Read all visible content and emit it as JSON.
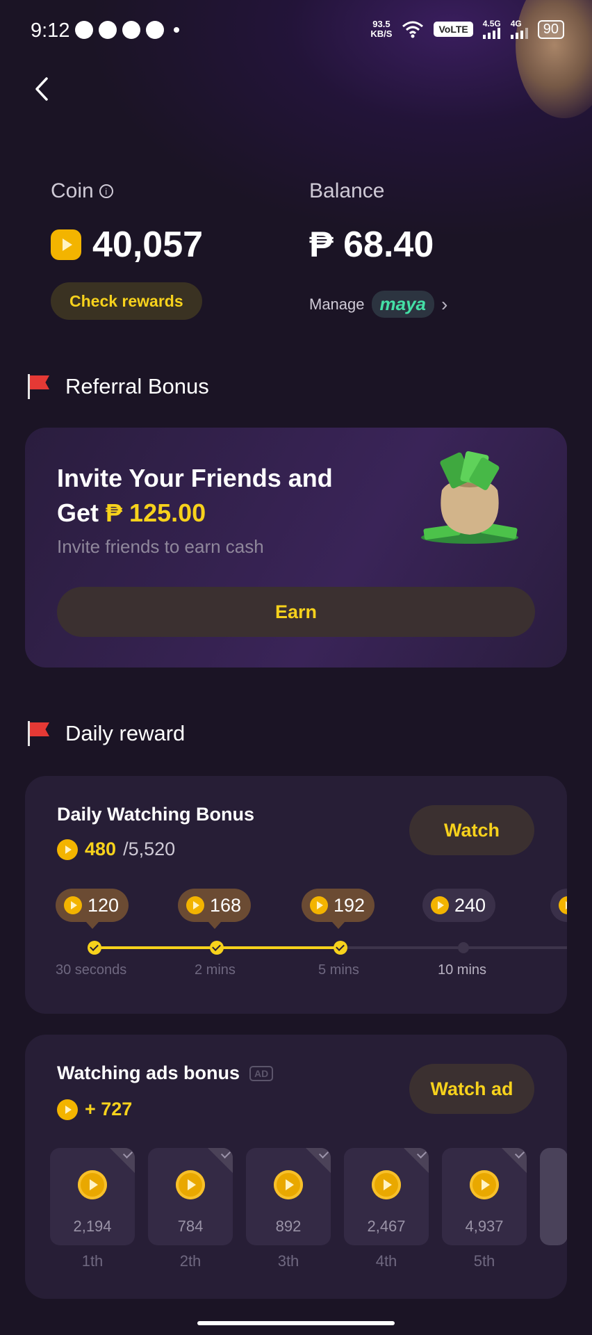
{
  "status_bar": {
    "time": "9:12",
    "net_speed_value": "93.5",
    "net_speed_unit": "KB/S",
    "volte": "VoLTE",
    "sim1": "4.5G",
    "sim2": "4G",
    "battery": "90"
  },
  "wallet": {
    "coin_label": "Coin",
    "coin_amount": "40,057",
    "check_rewards_label": "Check rewards",
    "balance_label": "Balance",
    "balance_amount": "₱ 68.40",
    "manage_label": "Manage",
    "maya_label": "maya"
  },
  "referral": {
    "section_title": "Referral Bonus",
    "title_line1": "Invite Your Friends and",
    "title_line2_prefix": "Get",
    "reward": "₱ 125.00",
    "subtitle": "Invite friends to earn cash",
    "earn_label": "Earn"
  },
  "daily": {
    "section_title": "Daily reward",
    "card_title": "Daily Watching Bonus",
    "progress_current": "480",
    "progress_total": "/5,520",
    "watch_label": "Watch",
    "milestones": [
      {
        "coins": "120",
        "time": "30 seconds",
        "done": true
      },
      {
        "coins": "168",
        "time": "2 mins",
        "done": true
      },
      {
        "coins": "192",
        "time": "5 mins",
        "done": true
      },
      {
        "coins": "240",
        "time": "10 mins",
        "done": false
      }
    ]
  },
  "ads": {
    "card_title": "Watching ads bonus",
    "ad_tag": "AD",
    "bonus": "+ 727",
    "watch_ad_label": "Watch ad",
    "tiles": [
      {
        "value": "2,194",
        "label": "1th"
      },
      {
        "value": "784",
        "label": "2th"
      },
      {
        "value": "892",
        "label": "3th"
      },
      {
        "value": "2,467",
        "label": "4th"
      },
      {
        "value": "4,937",
        "label": "5th"
      }
    ]
  },
  "colors": {
    "accent_yellow": "#f7d21c",
    "background": "#1b1425",
    "card": "#271e36",
    "maya_green": "#44e0a6"
  }
}
